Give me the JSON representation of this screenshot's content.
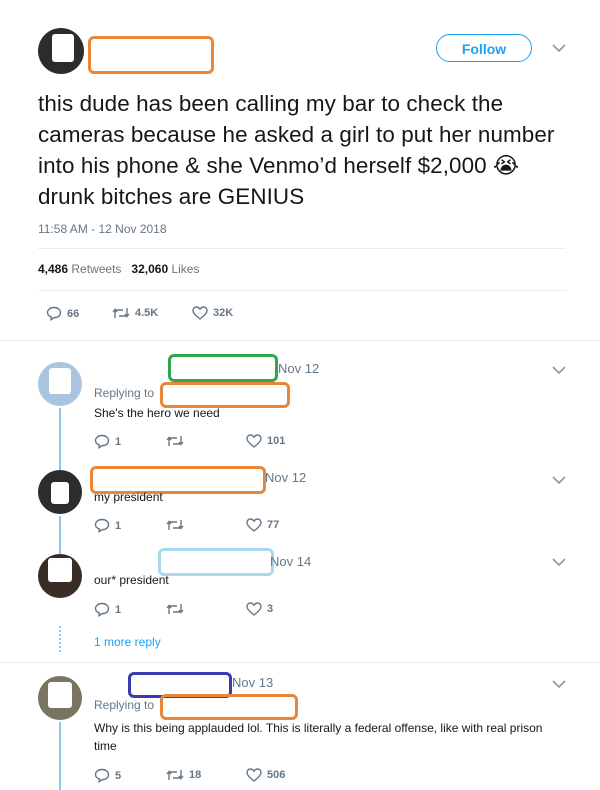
{
  "main_tweet": {
    "follow_label": "Follow",
    "text": "this dude has been calling my bar to check the cameras because he asked a girl to put her number into his phone & she Venmo’d herself $2,000 😭 drunk bitches are GENIUS",
    "timestamp": "11:58 AM - 12 Nov 2018",
    "retweets_count": "4,486",
    "retweets_label": "Retweets",
    "likes_count": "32,060",
    "likes_label": "Likes",
    "actions": {
      "replies": "66",
      "retweets": "4.5K",
      "likes": "32K"
    }
  },
  "replies": [
    {
      "date": "Nov 12",
      "replying_label": "Replying to",
      "text": "She's the hero we need",
      "replies": "1",
      "retweets": "",
      "likes": "101",
      "redact_color": "#2ea84a"
    },
    {
      "date": "Nov 12",
      "text": "my president",
      "replies": "1",
      "retweets": "",
      "likes": "77",
      "redact_color": "#e8863a"
    },
    {
      "date": "Nov 14",
      "text": "our* president",
      "replies": "1",
      "retweets": "",
      "likes": "3",
      "redact_color": "#a8d8ea"
    },
    {
      "date": "Nov 13",
      "replying_label": "Replying to",
      "text": "Why is this being applauded lol. This is literally a federal offense, like with real prison time",
      "replies": "5",
      "retweets": "18",
      "likes": "506",
      "redact_color": "#3b3bb0"
    }
  ],
  "more_replies_label": "1 more reply",
  "colors": {
    "accent": "#1da1f2",
    "redact_orange": "#e8863a",
    "muted": "#657786"
  }
}
